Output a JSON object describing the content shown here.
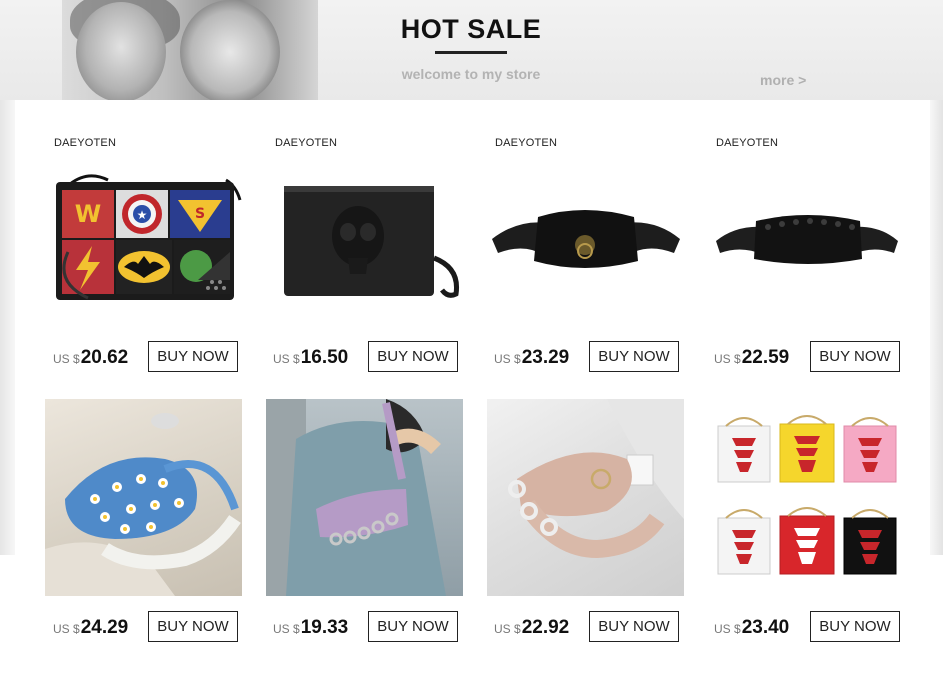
{
  "header": {
    "title": "HOT SALE",
    "subtitle": "welcome to my store",
    "more_label": "more >"
  },
  "currency": "US $",
  "buy_label": "BUY NOW",
  "products": [
    {
      "brand": "DAEYOTEN",
      "price": "20.62",
      "image": "superhero-patch-clutch"
    },
    {
      "brand": "DAEYOTEN",
      "price": "16.50",
      "image": "black-skull-clutch"
    },
    {
      "brand": "DAEYOTEN",
      "price": "23.29",
      "image": "black-lion-ring-waist-bag"
    },
    {
      "brand": "DAEYOTEN",
      "price": "22.59",
      "image": "black-studded-waist-bag"
    },
    {
      "brand": "",
      "price": "24.29",
      "image": "blue-daisy-chain-bag"
    },
    {
      "brand": "",
      "price": "19.33",
      "image": "purple-croc-shoulder-bag"
    },
    {
      "brand": "",
      "price": "22.92",
      "image": "pink-chain-waist-bag"
    },
    {
      "brand": "",
      "price": "23.40",
      "image": "pagoda-takeout-box-bags"
    }
  ]
}
